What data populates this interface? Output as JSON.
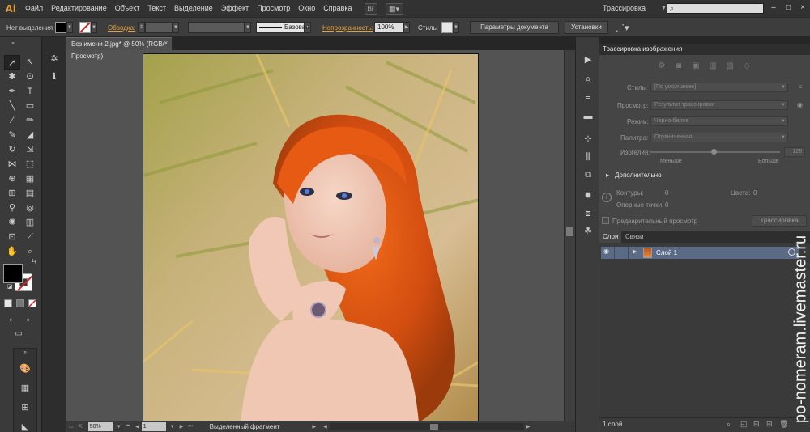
{
  "app": {
    "logo": "Ai",
    "menu": [
      "Файл",
      "Редактирование",
      "Объект",
      "Текст",
      "Выделение",
      "Эффект",
      "Просмотр",
      "Окно",
      "Справка"
    ],
    "workspace": "Трассировка",
    "br_label": "Br"
  },
  "control": {
    "selection": "Нет выделения",
    "stroke_label": "Обводка:",
    "brush_label": "Базовая",
    "opacity_label": "Непрозрачность:",
    "opacity_value": "100%",
    "style_label": "Стиль:",
    "doc_settings": "Параметры документа",
    "prefs": "Установки"
  },
  "document": {
    "tab_title": "Без имени-2.jpg* @ 50% (RGB/Просмотр)",
    "zoom": "50%",
    "artboard": "1",
    "status_text": "Выделенный фрагмент"
  },
  "trace": {
    "title": "Трассировка изображения",
    "preset_label": "Стиль:",
    "preset_value": "[По умолчанию]",
    "view_label": "Просмотр:",
    "view_value": "Результат трассировки",
    "mode_label": "Режим:",
    "mode_value": "Черно-белое",
    "palette_label": "Палитра:",
    "palette_value": "Ограниченная",
    "threshold_label": "Изогелия:",
    "threshold_value": "128",
    "less": "Меньше",
    "more": "Больше",
    "advanced": "Дополнительно",
    "paths_label": "Контуры:",
    "paths_value": "0",
    "colors_label": "Цвета:",
    "colors_value": "0",
    "anchors_label": "Опорные точки:",
    "anchors_value": "0",
    "preview_label": "Предварительный просмотр",
    "trace_button": "Трассировка"
  },
  "layers": {
    "tab_layers": "Слои",
    "tab_links": "Связи",
    "layer_name": "Слой 1",
    "count": "1 слой"
  },
  "watermark": "po-nomeram.livemaster.ru",
  "colors": {
    "accent_orange": "#e8a13a",
    "selected_layer": "#5b6a85",
    "stroke_none_red": "#d42020"
  }
}
